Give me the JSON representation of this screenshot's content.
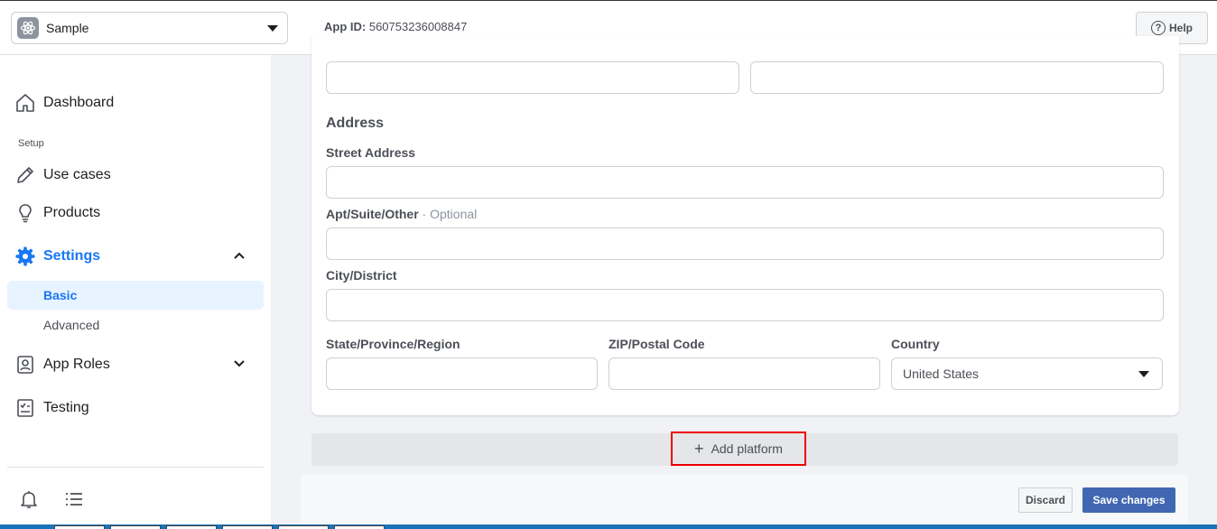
{
  "header": {
    "app_name": "Sample",
    "app_id_label": "App ID:",
    "app_id_value": "560753236008847",
    "help_label": "Help"
  },
  "sidebar": {
    "dashboard": "Dashboard",
    "setup_section": "Setup",
    "use_cases": "Use cases",
    "products": "Products",
    "settings": "Settings",
    "basic": "Basic",
    "advanced": "Advanced",
    "app_roles": "App Roles",
    "testing": "Testing"
  },
  "form": {
    "address_title": "Address",
    "street_label": "Street Address",
    "apt_label": "Apt/Suite/Other",
    "optional_suffix": " · Optional",
    "city_label": "City/District",
    "state_label": "State/Province/Region",
    "zip_label": "ZIP/Postal Code",
    "country_label": "Country",
    "country_value": "United States"
  },
  "actions": {
    "add_platform": "Add platform",
    "discard": "Discard",
    "save_changes": "Save changes"
  },
  "colors": {
    "accent": "#1877f2",
    "save_button": "#4267b2",
    "highlight_box": "#e00000"
  }
}
